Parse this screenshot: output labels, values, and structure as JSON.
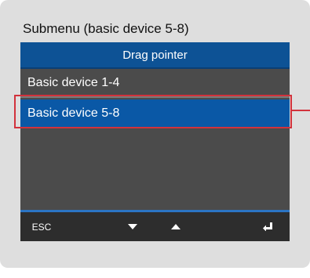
{
  "panel": {
    "title": "Submenu (basic device 5-8)"
  },
  "screen": {
    "header_title": "Drag pointer",
    "items": [
      {
        "label": "Basic device 1-4",
        "selected": false
      },
      {
        "label": "Basic device 5-8",
        "selected": true
      }
    ]
  },
  "softkeys": {
    "esc_label": "ESC",
    "down_icon": "triangle-down-icon",
    "up_icon": "triangle-up-icon",
    "enter_icon": "enter-arrow-icon"
  },
  "colors": {
    "header_blue": "#0d5295",
    "selected_blue": "#0a58a6",
    "highlight_red": "#d2323c",
    "screen_gray": "#4b4b4b",
    "softkey_bar": "#2d2d2d"
  }
}
